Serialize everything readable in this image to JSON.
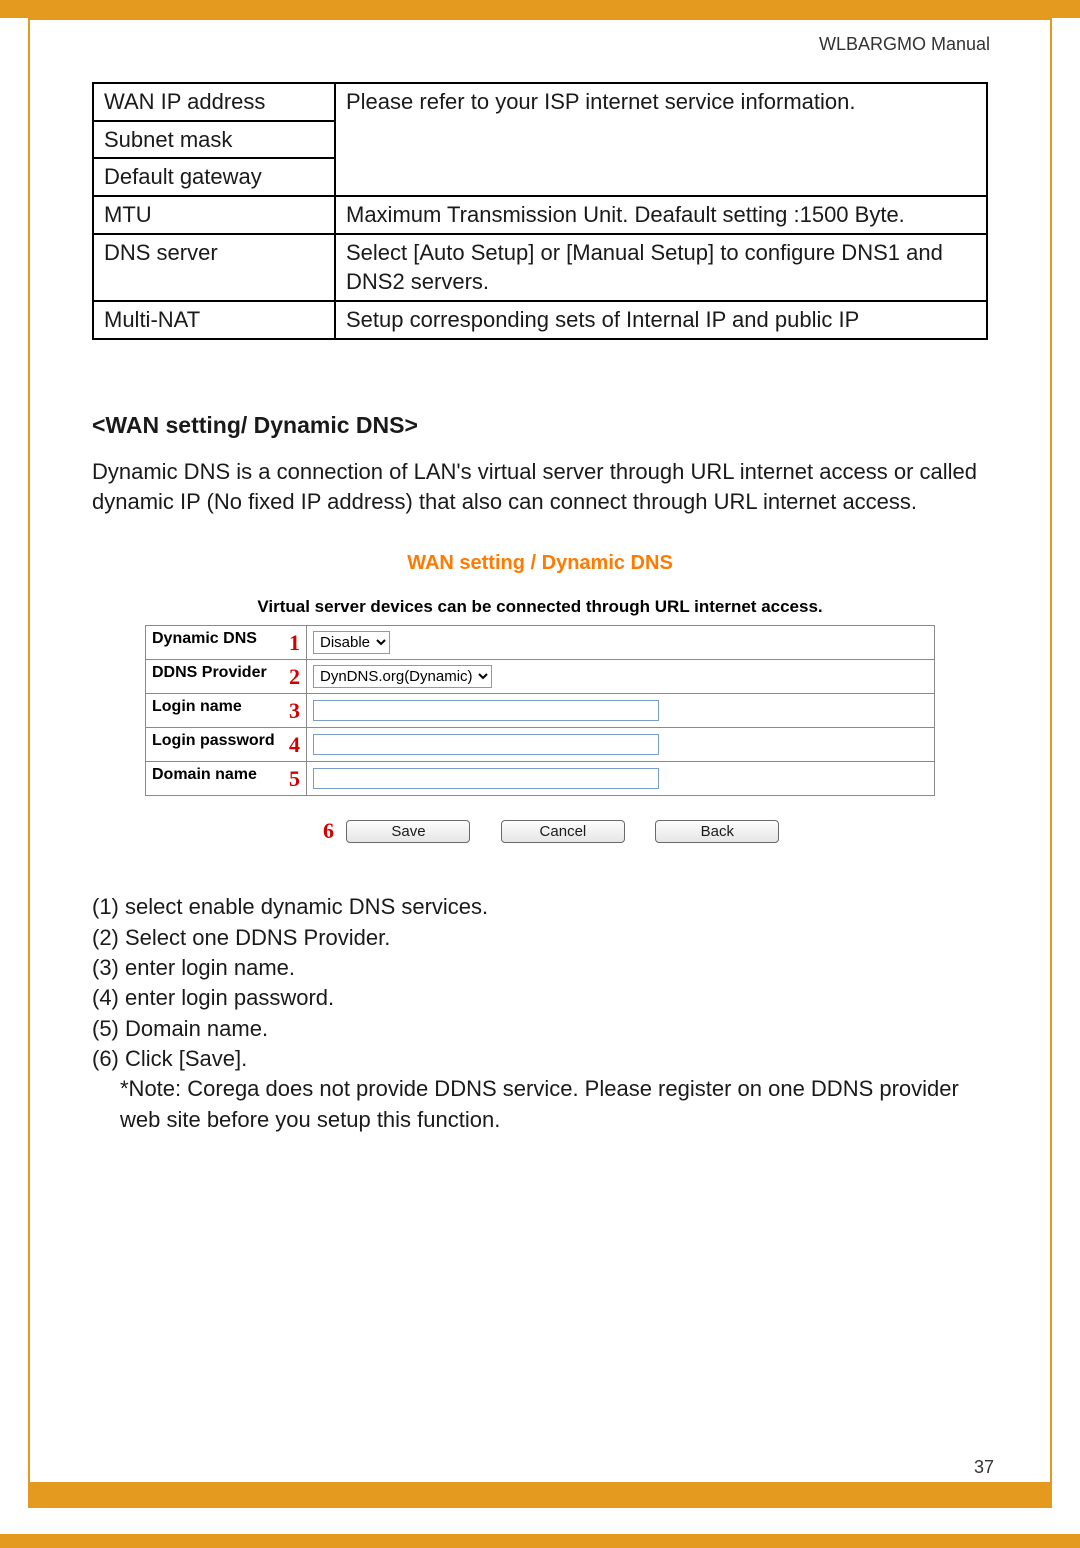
{
  "header": {
    "manual": "WLBARGMO Manual"
  },
  "spec_table": {
    "rows": {
      "wan_ip": "WAN IP address",
      "subnet": "Subnet mask",
      "gateway": "Default gateway",
      "isp_note": "Please refer to your ISP internet service information.",
      "mtu": "MTU",
      "mtu_desc": "Maximum Transmission Unit. Deafault setting :1500 Byte.",
      "dns": "DNS server",
      "dns_desc": "Select [Auto Setup] or [Manual Setup] to configure DNS1 and DNS2 servers.",
      "multinat": "Multi-NAT",
      "multinat_desc": "Setup corresponding sets of Internal IP and public IP"
    }
  },
  "section_heading": "<WAN setting/ Dynamic DNS>",
  "intro_para": "Dynamic DNS is a connection of LAN's virtual server through URL internet access or called dynamic IP (No fixed IP address) that also can connect through URL internet access.",
  "screenshot": {
    "title": "WAN setting / Dynamic DNS",
    "subtitle": "Virtual server devices can be connected through URL internet access.",
    "rows": {
      "ddns": {
        "label": "Dynamic DNS",
        "num": "1",
        "select_value": "Disable"
      },
      "provider": {
        "label": "DDNS Provider",
        "num": "2",
        "select_value": "DynDNS.org(Dynamic)"
      },
      "login": {
        "label": "Login name",
        "num": "3"
      },
      "password": {
        "label": "Login password",
        "num": "4"
      },
      "domain": {
        "label": "Domain name",
        "num": "5"
      }
    },
    "buttons": {
      "num": "6",
      "save": "Save",
      "cancel": "Cancel",
      "back": "Back"
    }
  },
  "steps": {
    "s1": "(1) select enable dynamic DNS services.",
    "s2": "(2) Select one DDNS Provider.",
    "s3": "(3) enter login name.",
    "s4": "(4) enter login password.",
    "s5": "(5) Domain name.",
    "s6": "(6) Click [Save].",
    "note": "*Note: Corega does not provide DDNS service.  Please register on one DDNS provider web site before you setup this function."
  },
  "page_number": "37"
}
